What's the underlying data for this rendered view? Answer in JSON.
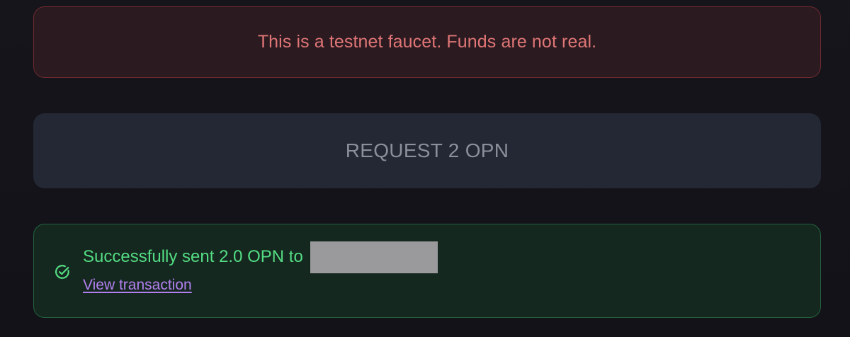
{
  "warning": {
    "text": "This is a testnet faucet. Funds are not real."
  },
  "request": {
    "label": "REQUEST 2 OPN"
  },
  "success": {
    "message": "Successfully sent 2.0 OPN to",
    "link_label": "View transaction",
    "icon": "check-circle-icon"
  },
  "colors": {
    "warning_text": "#e07676",
    "success_text": "#53dc83",
    "link": "#b27ff0",
    "button_bg": "#232834"
  }
}
